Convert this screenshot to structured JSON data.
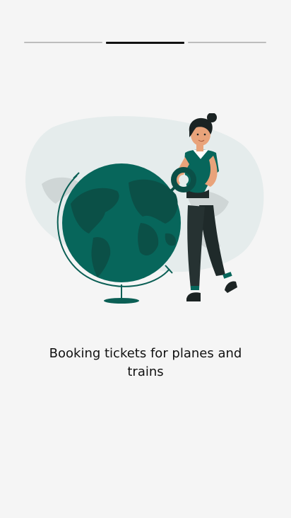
{
  "onboarding": {
    "total_steps": 3,
    "current_step": 2,
    "caption": "Booking tickets for planes and trains",
    "illustration": "woman-with-globe-illustration"
  },
  "colors": {
    "background": "#f5f5f5",
    "accent": "#07665b",
    "accent_dark": "#0b4f47",
    "progress_active": "#111111",
    "progress_inactive": "#bdbdbd"
  }
}
